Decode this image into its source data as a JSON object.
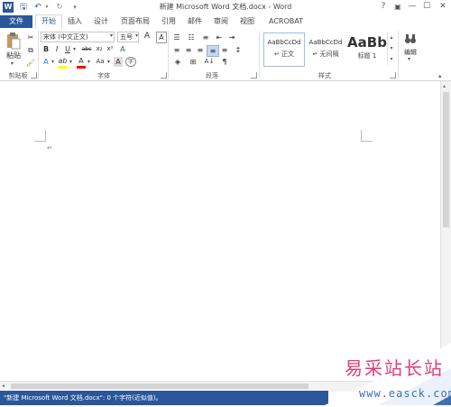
{
  "window": {
    "title": "新建 Microsoft Word 文档.docx - Word",
    "help": "?",
    "ribbon_options": "▣",
    "minimize": "—",
    "maximize": "☐",
    "close": "✕"
  },
  "quick_access": {
    "app_icon": "W",
    "save": "🖫",
    "undo": "↶",
    "redo": "↻",
    "customize": "▾"
  },
  "tabs": [
    "文件",
    "开始",
    "插入",
    "设计",
    "页面布局",
    "引用",
    "邮件",
    "审阅",
    "视图",
    "ACROBAT"
  ],
  "ribbon": {
    "clipboard": {
      "paste_label": "粘贴",
      "group_label": "剪贴板"
    },
    "font": {
      "font_name": "宋体 (中文正文)",
      "font_size": "五号",
      "grow": "A",
      "shrink": "A",
      "change_case": "Aa",
      "clear_format": "A",
      "wen": "wén",
      "border_char": "A",
      "bold": "B",
      "italic": "I",
      "underline": "U",
      "strike": "abc",
      "subscript": "x₂",
      "superscript": "x²",
      "effects": "A",
      "highlight": "ab",
      "font_color": "A",
      "shading": "A",
      "char_border": "A",
      "enclose": "字",
      "group_label": "字体"
    },
    "paragraph": {
      "group_label": "段落",
      "sort": "A↓",
      "marks": "¶"
    },
    "styles": {
      "items": [
        {
          "sample": "AaBbCcDd",
          "name": "↵ 正文"
        },
        {
          "sample": "AaBbCcDd",
          "name": "↵ 无间隔"
        },
        {
          "sample": "AaBb",
          "name": "标题 1"
        }
      ],
      "group_label": "样式"
    },
    "editing": {
      "label": "编辑"
    }
  },
  "document": {
    "paragraph_mark": "↵"
  },
  "status": {
    "text": "\"新建 Microsoft Word 文档.docx\": 0 个字符(近似值)。"
  },
  "watermark": {
    "site_name": "易采站长站",
    "url": "www.easck.com"
  },
  "colors": {
    "accent": "#2b579a",
    "highlight": "#ffff00",
    "font_color": "#ff0000",
    "watermark_pink": "#e53a7a"
  }
}
